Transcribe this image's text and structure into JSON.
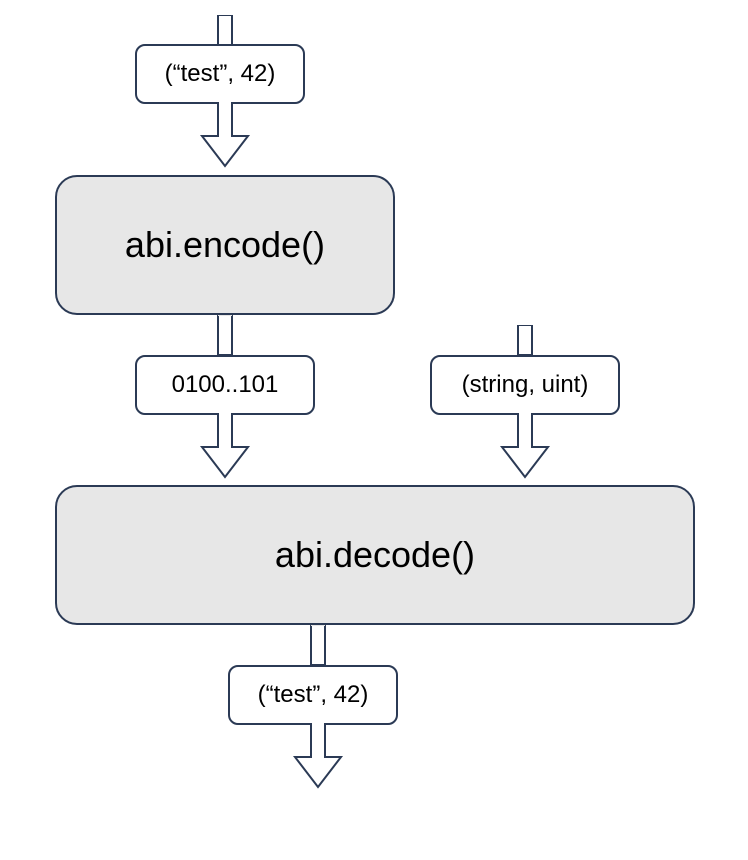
{
  "nodes": {
    "input_tuple": "(“test”, 42)",
    "encode_fn": "abi.encode()",
    "encoded_bytes": "0100..101",
    "type_tuple": "(string, uint)",
    "decode_fn": "abi.decode()",
    "output_tuple": "(“test”, 42)"
  }
}
